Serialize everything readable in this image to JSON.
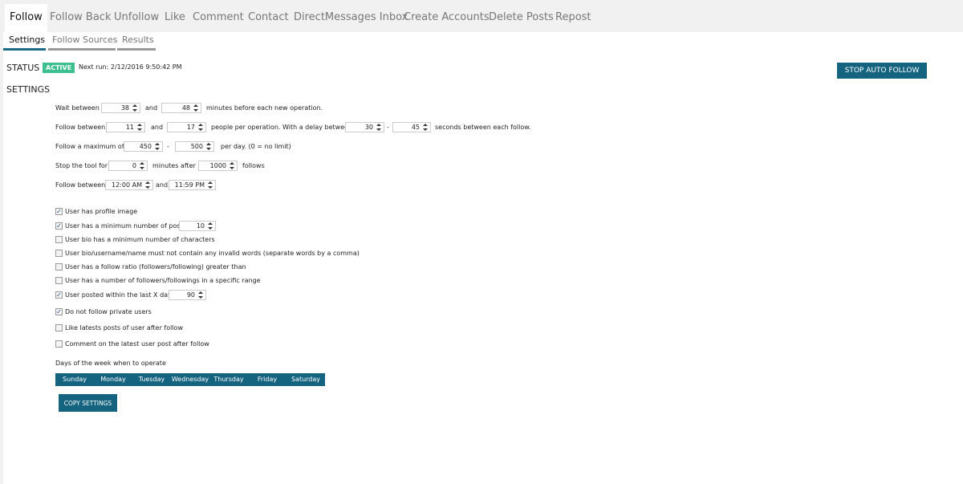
{
  "top_tabs": [
    "Follow",
    "Follow Back",
    "Unfollow",
    "Like",
    "Comment",
    "Contact",
    "DirectMessages Inbox",
    "Create Accounts",
    "Delete Posts",
    "Repost"
  ],
  "sub_tabs": [
    "Settings",
    "Follow Sources",
    "Results"
  ],
  "status": {
    "label": "STATUS",
    "badge": "ACTIVE",
    "next_run": "Next run: 2/12/2016 9:50:42 PM",
    "stop_button": "STOP AUTO FOLLOW",
    "badge_color": "#3dbf8f",
    "accent_color": "#14637f"
  },
  "settings_heading": "SETTINGS",
  "rows": {
    "wait": {
      "prefix": "Wait between",
      "min": "38",
      "and": "and",
      "max": "48",
      "suffix": "minutes before each new operation."
    },
    "follow": {
      "prefix": "Follow between",
      "min": "11",
      "and": "and",
      "max": "17",
      "mid": "people per operation. With a delay between",
      "delay_min": "30",
      "dash": "-",
      "delay_max": "45",
      "suffix": "seconds between each follow."
    },
    "max": {
      "prefix": "Follow a maximum of",
      "min": "450",
      "dash": "-",
      "max": "500",
      "suffix": "per day. (0 = no limit)"
    },
    "stop": {
      "prefix": "Stop the tool for",
      "minutes": "0",
      "mid": "minutes after",
      "follows": "1000",
      "suffix": "follows"
    },
    "time": {
      "prefix": "Follow between",
      "start": "12:00 AM",
      "and": "and",
      "end": "11:59 PM"
    }
  },
  "checkboxes": [
    {
      "label": "User has profile image",
      "checked": true
    },
    {
      "label": "User has a minimum number of posts",
      "checked": true,
      "value": "10"
    },
    {
      "label": "User bio has a minimum number of characters",
      "checked": false
    },
    {
      "label": "User bio/username/name must not contain any invalid words (separate words by a comma)",
      "checked": false
    },
    {
      "label": "User has a follow ratio (followers/following) greater than",
      "checked": false
    },
    {
      "label": "User has a number of followers/followings in a specific range",
      "checked": false
    },
    {
      "label": "User posted within the last X days",
      "checked": true,
      "value": "90"
    },
    {
      "label": "Do not follow private users",
      "checked": true
    },
    {
      "label": "Like latests posts of user after follow",
      "checked": false
    },
    {
      "label": "Comment on the latest user post after follow",
      "checked": false
    }
  ],
  "days_label": "Days of the week when to operate",
  "days": [
    "Sunday",
    "Monday",
    "Tuesday",
    "Wednesday",
    "Thursday",
    "Friday",
    "Saturday"
  ],
  "copy_button": "COPY SETTINGS"
}
